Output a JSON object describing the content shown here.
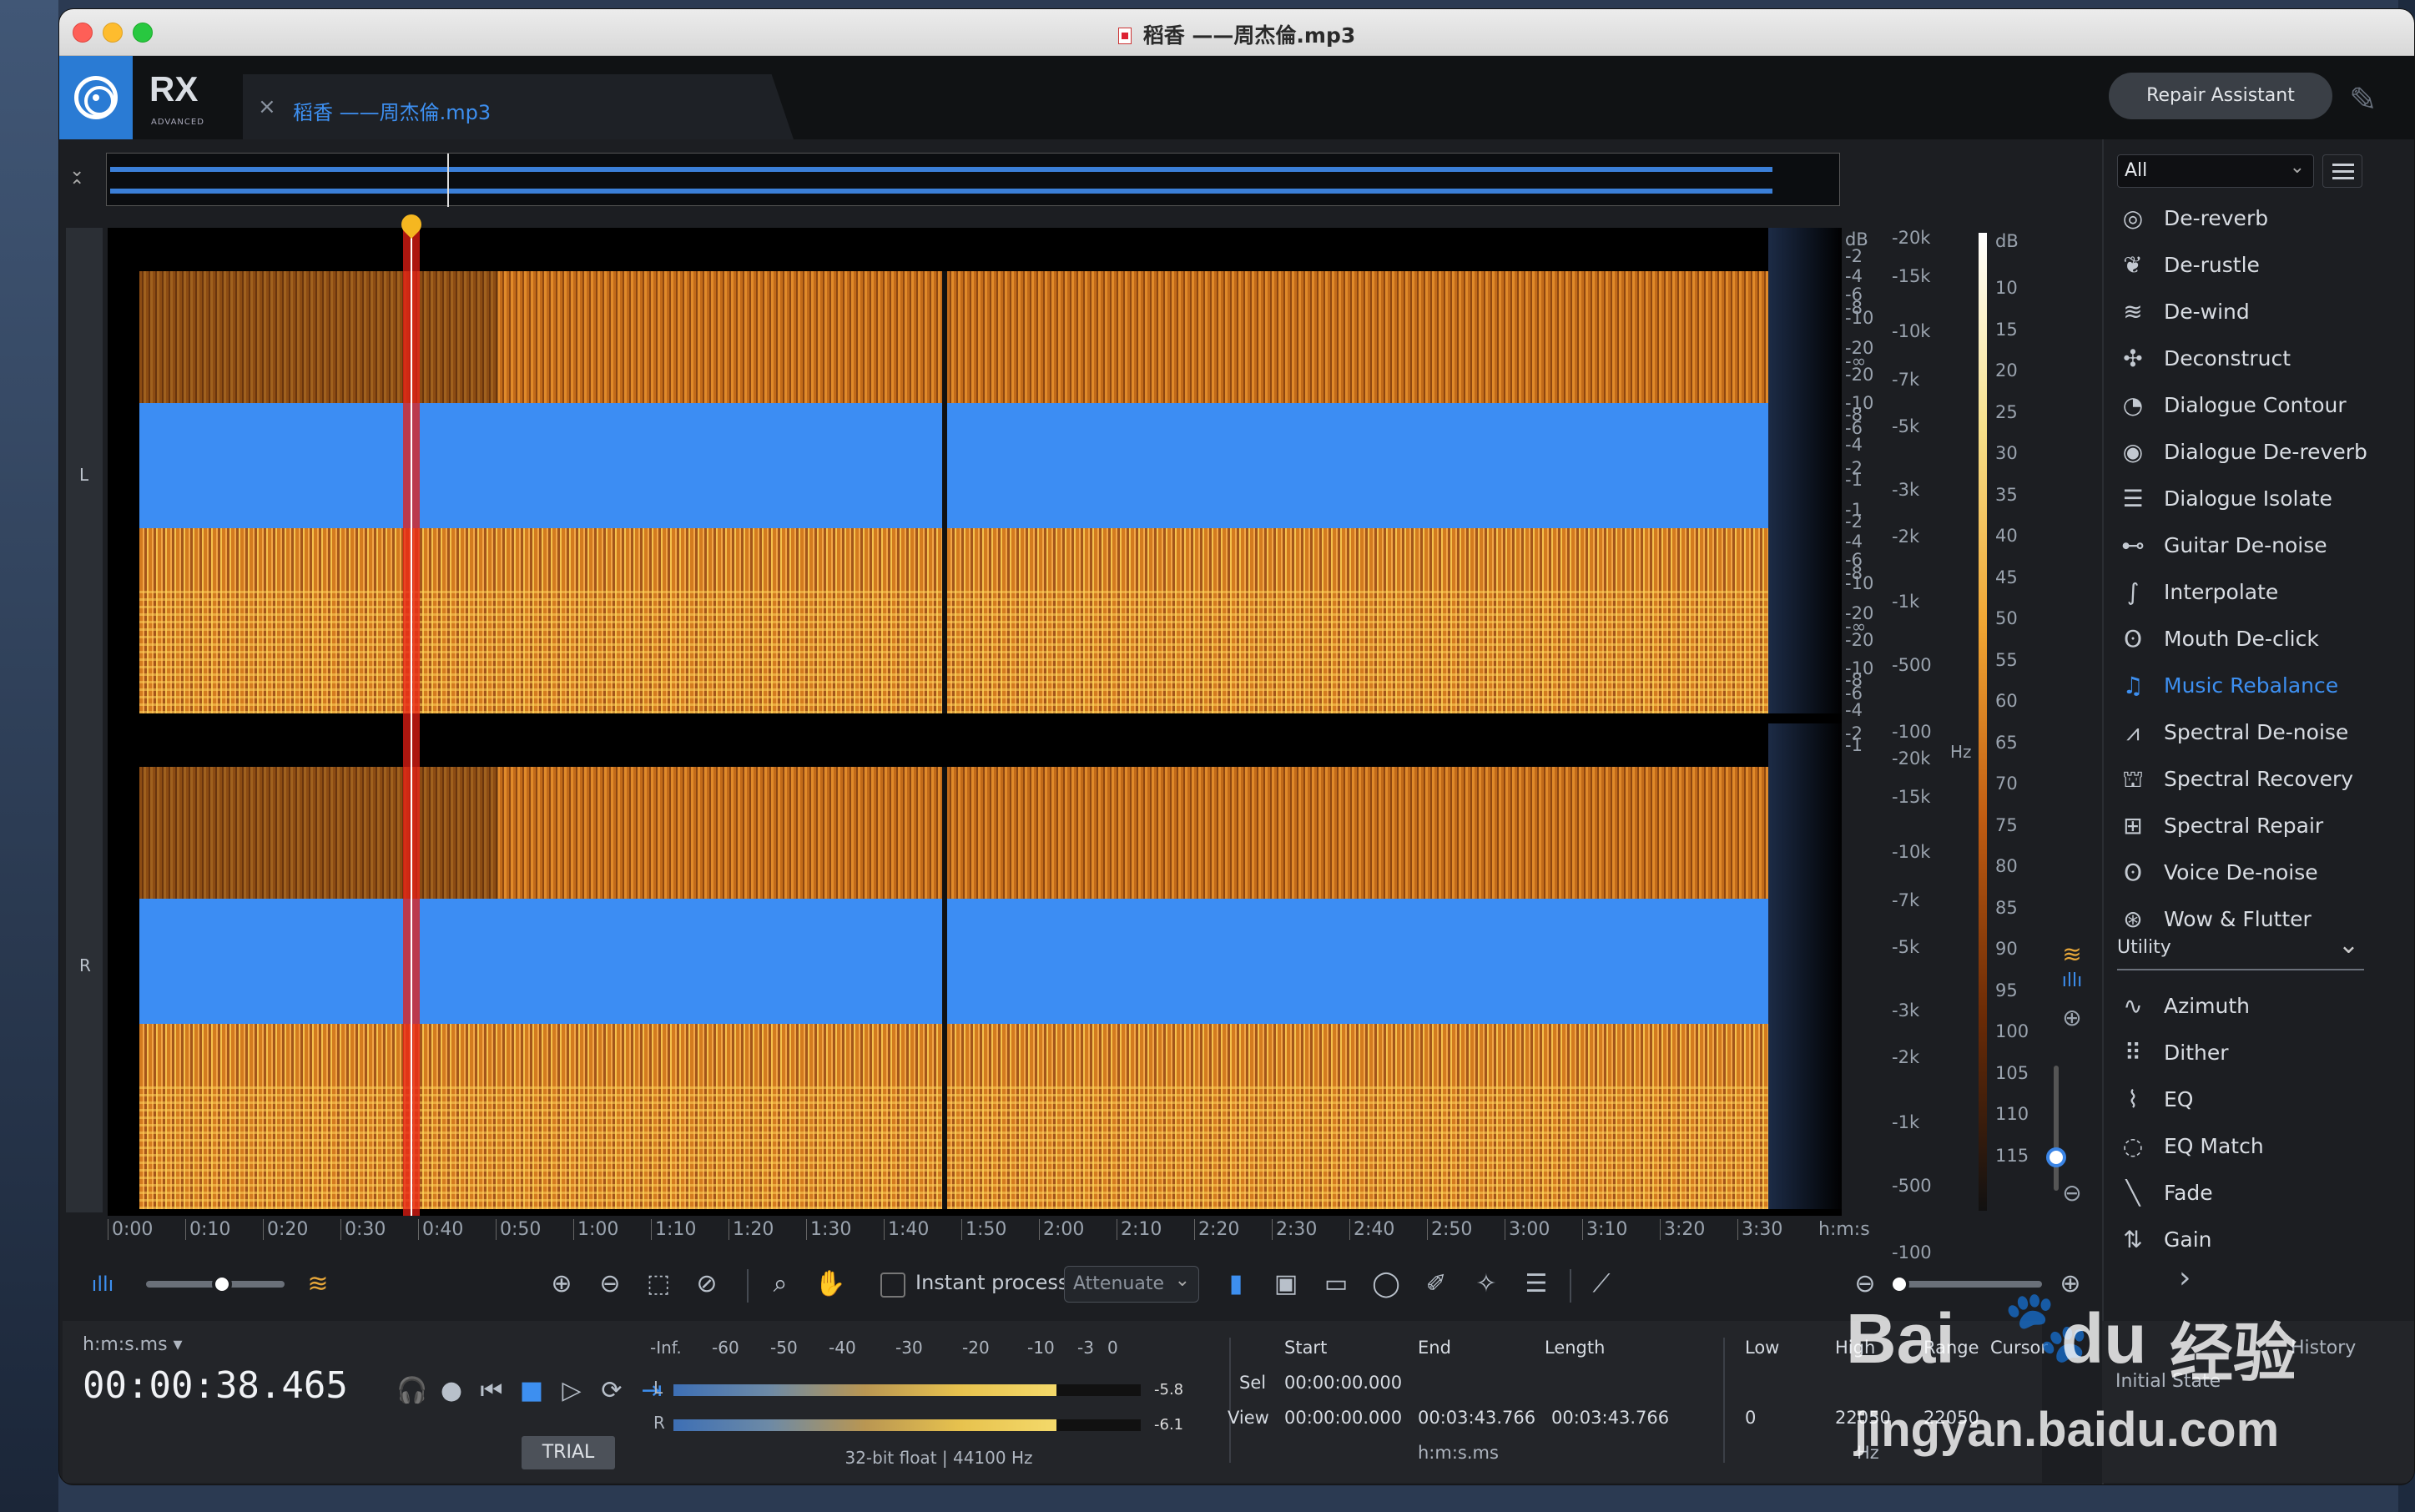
{
  "window_title": "稻香 ——周杰倫.mp3",
  "app": {
    "brand": "RX",
    "edition": "ADVANCED"
  },
  "file_tab": {
    "close": "×",
    "name": "稻香 ——周杰倫.mp3"
  },
  "repair_assistant": "Repair Assistant",
  "channels": {
    "left": "L",
    "right": "R"
  },
  "db_scale_top": [
    "dB",
    "-2",
    "-4",
    "-6",
    "-8",
    "-10",
    "-20",
    "-∞",
    "-20",
    "-10",
    "-8",
    "-6",
    "-4",
    "-2",
    "-1"
  ],
  "db_scale_bottom": [
    "-1",
    "-2",
    "-4",
    "-6",
    "-8",
    "-10",
    "-20",
    "-∞",
    "-20",
    "-10",
    "-8",
    "-6",
    "-4",
    "-2",
    "-1"
  ],
  "hz_scale_top": [
    "-20k",
    "-15k",
    "-10k",
    "-7k",
    "-5k",
    "-3k",
    "-2k",
    "-1k",
    "-500",
    "-100"
  ],
  "hz_unit": "Hz",
  "hz_scale_bottom": [
    "-20k",
    "-15k",
    "-10k",
    "-7k",
    "-5k",
    "-3k",
    "-2k",
    "-1k",
    "-500",
    "-100"
  ],
  "colorbar_scale": [
    "dB",
    "10",
    "15",
    "20",
    "25",
    "30",
    "35",
    "40",
    "45",
    "50",
    "55",
    "60",
    "65",
    "70",
    "75",
    "80",
    "85",
    "90",
    "95",
    "100",
    "105",
    "110",
    "115"
  ],
  "time_axis": [
    "0:00",
    "0:10",
    "0:20",
    "0:30",
    "0:40",
    "0:50",
    "1:00",
    "1:10",
    "1:20",
    "1:30",
    "1:40",
    "1:50",
    "2:00",
    "2:10",
    "2:20",
    "2:30",
    "2:40",
    "2:50",
    "3:00",
    "3:10",
    "3:20",
    "3:30",
    "h:m:s"
  ],
  "playhead_time_seconds": 38.465,
  "toolbar": {
    "instant_process": "Instant process",
    "attenuate": "Attenuate",
    "spectrogram_slider": 0.55,
    "zoom_slider": 0.05
  },
  "transport": {
    "time_format": "h:m:s.ms",
    "time_value": "00:00:38.465",
    "trial": "TRIAL"
  },
  "meter": {
    "scale": [
      "-Inf.",
      "-60",
      "-50",
      "-40",
      "-30",
      "-20",
      "-10",
      "-3",
      "0"
    ],
    "left_label": "L",
    "right_label": "R",
    "left_peak": "-5.8",
    "right_peak": "-6.1",
    "left_level": 0.82,
    "right_level": 0.82,
    "format": "32-bit float | 44100 Hz"
  },
  "selection": {
    "start_h": "Start",
    "end_h": "End",
    "length_h": "Length",
    "sel_label": "Sel",
    "sel_start": "00:00:00.000",
    "view_label": "View",
    "view_start": "00:00:00.000",
    "view_end": "00:03:43.766",
    "view_length": "00:03:43.766",
    "unit": "h:m:s.ms"
  },
  "frequency": {
    "low_h": "Low",
    "high_h": "High",
    "range_h": "Range",
    "cursor_h": "Cursor",
    "low": "0",
    "high": "22050",
    "range": "22050",
    "unit": "Hz"
  },
  "history": {
    "title": "History",
    "initial": "Initial State"
  },
  "panel": {
    "filter": "All",
    "modules": [
      {
        "label": "De-reverb",
        "icon": "◎"
      },
      {
        "label": "De-rustle",
        "icon": "❦"
      },
      {
        "label": "De-wind",
        "icon": "≋"
      },
      {
        "label": "Deconstruct",
        "icon": "✣"
      },
      {
        "label": "Dialogue Contour",
        "icon": "◔"
      },
      {
        "label": "Dialogue De-reverb",
        "icon": "◉"
      },
      {
        "label": "Dialogue Isolate",
        "icon": "☰"
      },
      {
        "label": "Guitar De-noise",
        "icon": "⊷"
      },
      {
        "label": "Interpolate",
        "icon": "∫"
      },
      {
        "label": "Mouth De-click",
        "icon": "ʘ"
      },
      {
        "label": "Music Rebalance",
        "icon": "♫"
      },
      {
        "label": "Spectral De-noise",
        "icon": "⩘"
      },
      {
        "label": "Spectral Recovery",
        "icon": "⛫"
      },
      {
        "label": "Spectral Repair",
        "icon": "⊞"
      },
      {
        "label": "Voice De-noise",
        "icon": "ʘ"
      },
      {
        "label": "Wow & Flutter",
        "icon": "⊛"
      }
    ],
    "utility_header": "Utility",
    "utility": [
      {
        "label": "Azimuth",
        "icon": "∿"
      },
      {
        "label": "Dither",
        "icon": "⠿"
      },
      {
        "label": "EQ",
        "icon": "⌇"
      },
      {
        "label": "EQ Match",
        "icon": "◌"
      },
      {
        "label": "Fade",
        "icon": "╲"
      },
      {
        "label": "Gain",
        "icon": "⇅"
      }
    ],
    "selected": "Music Rebalance"
  },
  "watermark": {
    "brand": "Bai",
    "paw": "du",
    "suffix": "经验",
    "url": "jingyan.baidu.com"
  }
}
